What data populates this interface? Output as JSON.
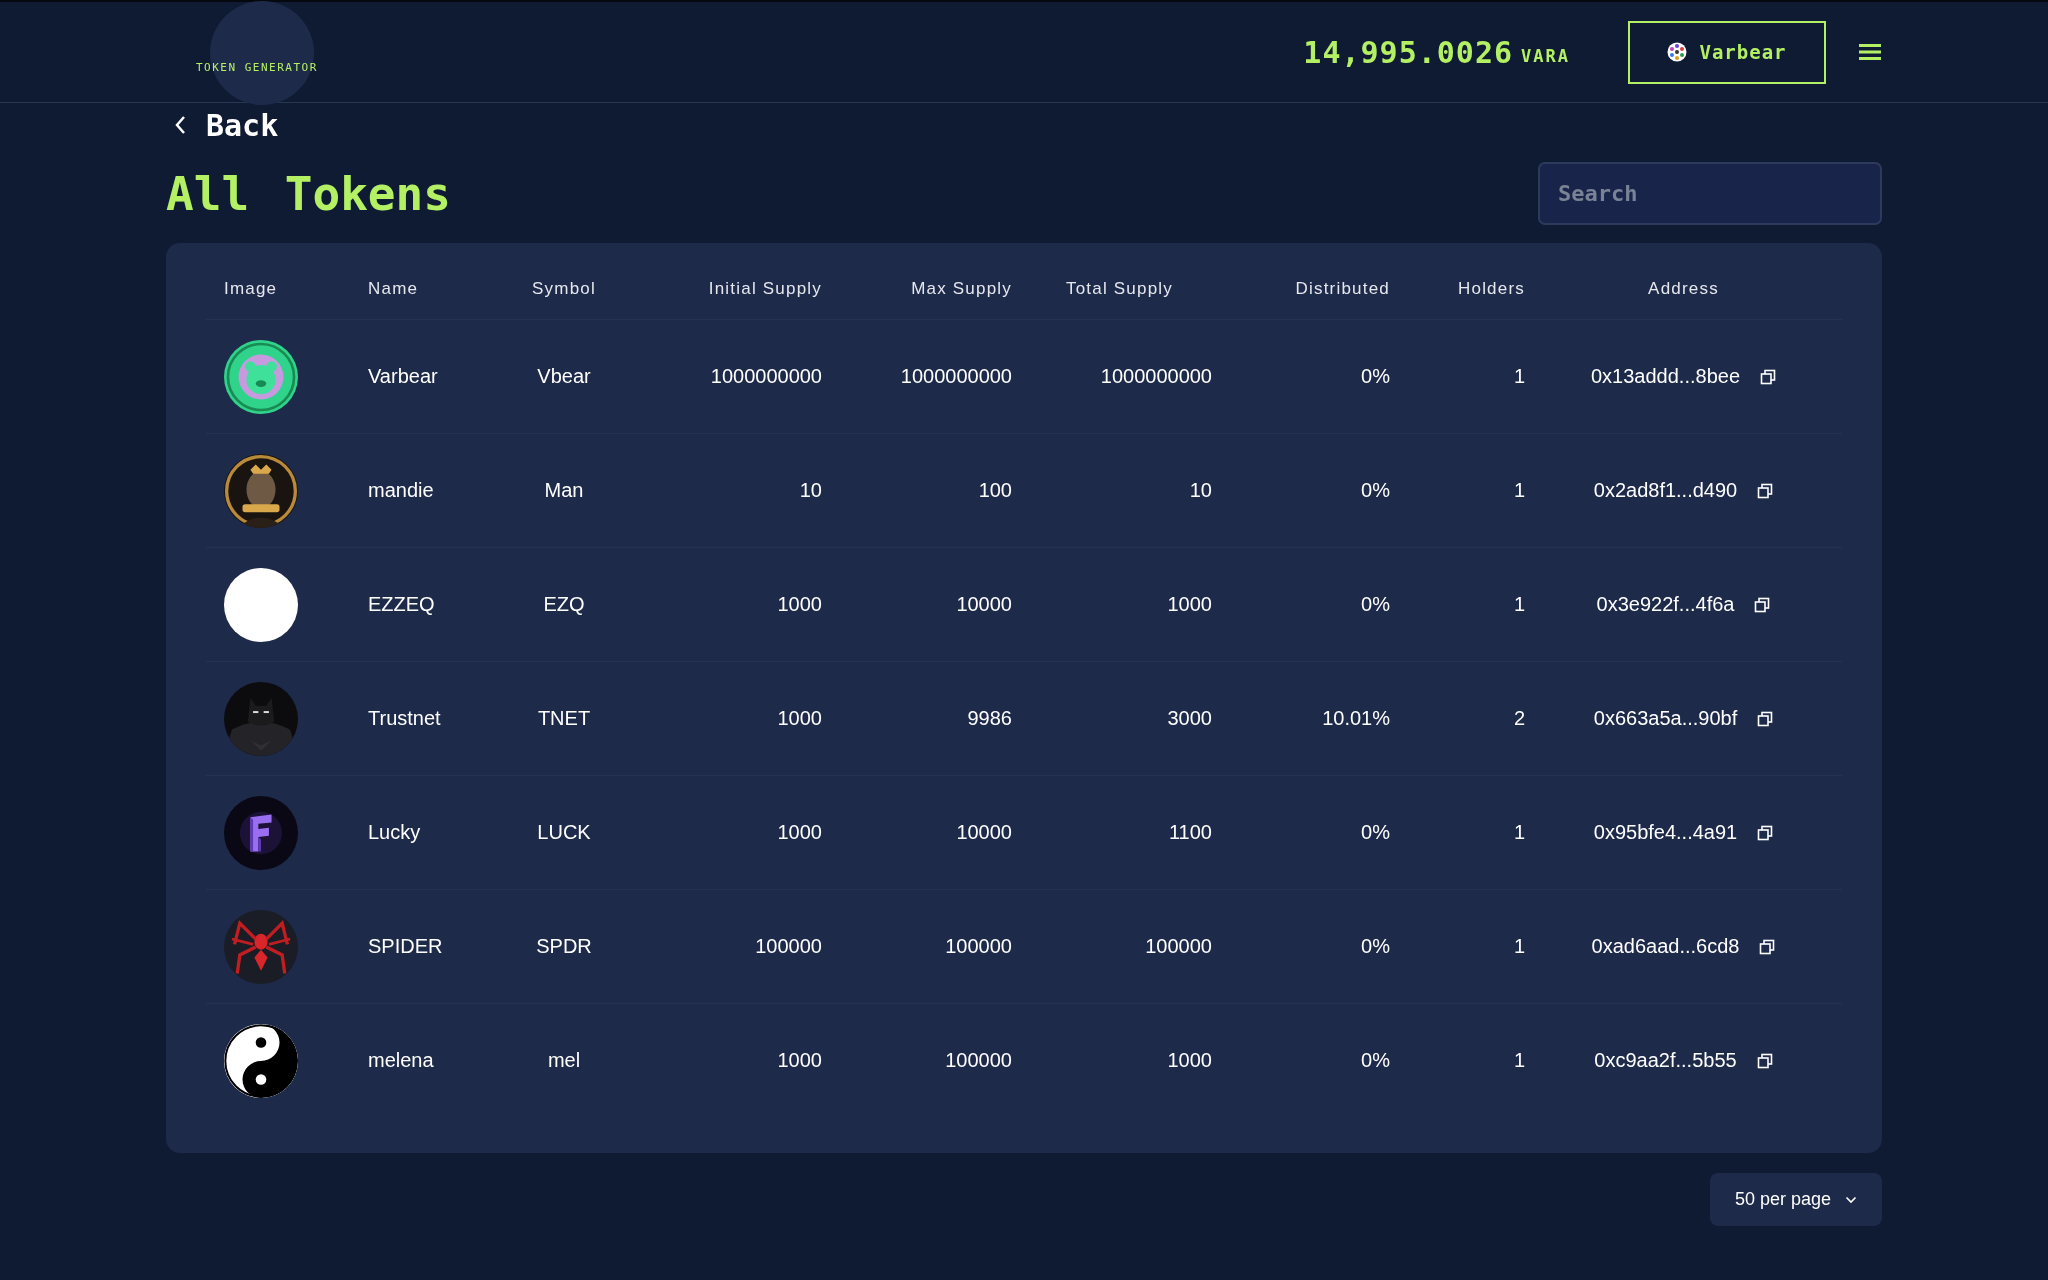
{
  "header": {
    "logo_text": "TOKEN GENERATOR",
    "balance": "14,995.0026",
    "currency": "VARA",
    "account_button": "Varbear"
  },
  "back_link": "Back",
  "title": "All Tokens",
  "search": {
    "placeholder": "Search"
  },
  "table": {
    "columns": [
      "Image",
      "Name",
      "Symbol",
      "Initial Supply",
      "Max Supply",
      "Total Supply",
      "Distributed",
      "Holders",
      "Address"
    ],
    "rows": [
      {
        "name": "Varbear",
        "symbol": "Vbear",
        "initial_supply": "1000000000",
        "max_supply": "1000000000",
        "total_supply": "1000000000",
        "distributed": "0%",
        "holders": "1",
        "address": "0x13addd...8bee"
      },
      {
        "name": "mandie",
        "symbol": "Man",
        "initial_supply": "10",
        "max_supply": "100",
        "total_supply": "10",
        "distributed": "0%",
        "holders": "1",
        "address": "0x2ad8f1...d490"
      },
      {
        "name": "EZZEQ",
        "symbol": "EZQ",
        "initial_supply": "1000",
        "max_supply": "10000",
        "total_supply": "1000",
        "distributed": "0%",
        "holders": "1",
        "address": "0x3e922f...4f6a"
      },
      {
        "name": "Trustnet",
        "symbol": "TNET",
        "initial_supply": "1000",
        "max_supply": "9986",
        "total_supply": "3000",
        "distributed": "10.01%",
        "holders": "2",
        "address": "0x663a5a...90bf"
      },
      {
        "name": "Lucky",
        "symbol": "LUCK",
        "initial_supply": "1000",
        "max_supply": "10000",
        "total_supply": "1100",
        "distributed": "0%",
        "holders": "1",
        "address": "0x95bfe4...4a91"
      },
      {
        "name": "SPIDER",
        "symbol": "SPDR",
        "initial_supply": "100000",
        "max_supply": "100000",
        "total_supply": "100000",
        "distributed": "0%",
        "holders": "1",
        "address": "0xad6aad...6cd8"
      },
      {
        "name": "melena",
        "symbol": "mel",
        "initial_supply": "1000",
        "max_supply": "100000",
        "total_supply": "1000",
        "distributed": "0%",
        "holders": "1",
        "address": "0xc9aa2f...5b55"
      }
    ]
  },
  "pagination": {
    "per_page": "50 per page"
  }
}
